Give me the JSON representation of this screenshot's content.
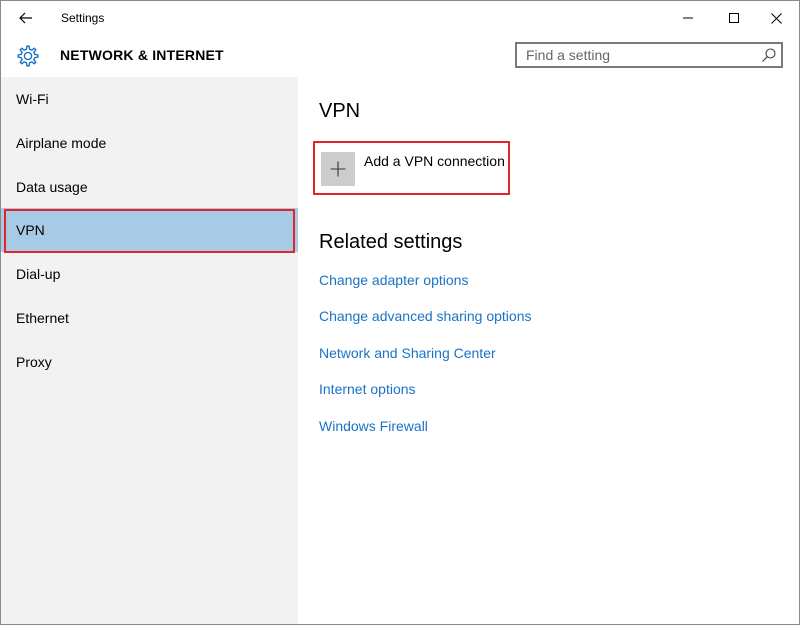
{
  "window": {
    "title": "Settings",
    "icons": {
      "back": "back-arrow-icon",
      "minimize": "minimize-icon",
      "maximize": "maximize-icon",
      "close": "close-icon"
    }
  },
  "header": {
    "section_title": "NETWORK & INTERNET",
    "section_icon": "gear-icon",
    "search": {
      "placeholder": "Find a setting",
      "value": "",
      "icon": "search-icon"
    }
  },
  "sidebar": {
    "items": [
      {
        "label": "Wi-Fi",
        "selected": false
      },
      {
        "label": "Airplane mode",
        "selected": false
      },
      {
        "label": "Data usage",
        "selected": false
      },
      {
        "label": "VPN",
        "selected": true
      },
      {
        "label": "Dial-up",
        "selected": false
      },
      {
        "label": "Ethernet",
        "selected": false
      },
      {
        "label": "Proxy",
        "selected": false
      }
    ],
    "selected_color": "#a8cbe5"
  },
  "main": {
    "title": "VPN",
    "add_vpn": {
      "label": "Add a VPN connection",
      "icon": "plus-icon"
    },
    "related_title": "Related settings",
    "related_links": [
      {
        "label": "Change adapter options"
      },
      {
        "label": "Change advanced sharing options"
      },
      {
        "label": "Network and Sharing Center"
      },
      {
        "label": "Internet options"
      },
      {
        "label": "Windows Firewall"
      }
    ],
    "link_color": "#1a73c5"
  },
  "highlight_color": "#e0262b"
}
